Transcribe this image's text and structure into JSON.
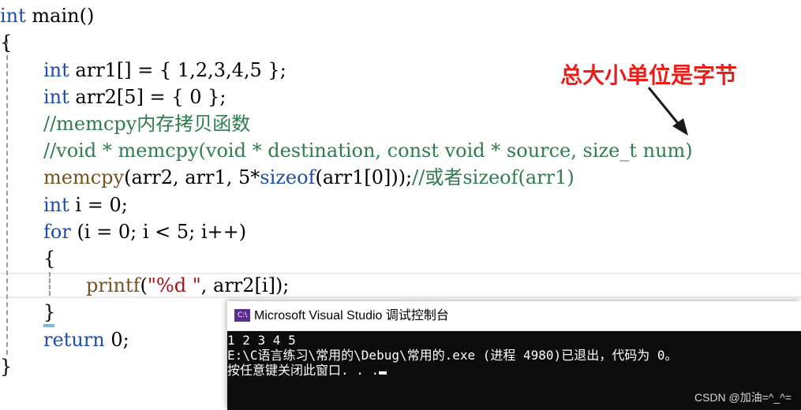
{
  "code": {
    "line_01": {
      "type": "int",
      "rest": " main()"
    },
    "line_02": {
      "text": "{"
    },
    "line_03": {
      "type": "int",
      "rest": " arr1[] = { 1,2,3,4,5 };"
    },
    "line_04": {
      "type": "int",
      "rest": " arr2[5] = { 0 };"
    },
    "line_05": {
      "comment": "//memcpy内存拷贝函数"
    },
    "line_06": {
      "comment": "//void * memcpy(void * destination, const void * source, size_t num)"
    },
    "line_07": {
      "fn": "memcpy",
      "args_a": "(arr2, arr1, 5*",
      "kw": "sizeof",
      "args_b": "(arr1[0]));",
      "comment": "//或者sizeof(arr1)"
    },
    "line_08": {
      "type": "int",
      "rest": " i = 0;"
    },
    "line_09": {
      "kw": "for",
      "rest": " (i = 0; i < 5; i++)"
    },
    "line_10": {
      "text": "{"
    },
    "line_11": {
      "fn": "printf",
      "open": "(",
      "str": "\"%d \"",
      "rest": ", arr2[i]);"
    },
    "line_12": {
      "text": "}"
    },
    "line_13": {
      "kw": "return",
      "rest": " 0;"
    },
    "line_14": {
      "text": "}"
    }
  },
  "annotation": {
    "text": "总大小单位是字节",
    "color": "#e8201c"
  },
  "console": {
    "title": "Microsoft Visual Studio 调试控制台",
    "icon": "visual-studio-icon",
    "lines": [
      "1 2 3 4 5",
      "E:\\C语言练习\\常用的\\Debug\\常用的.exe (进程 4980)已退出，代码为 0。",
      "按任意键关闭此窗口. . ."
    ]
  },
  "watermark": "CSDN @加油=^_^=",
  "colors": {
    "keyword": "#1d4ea8",
    "function": "#74531f",
    "comment": "#2e7d4f",
    "string": "#a31515",
    "console_bg": "#0c0c0c"
  }
}
